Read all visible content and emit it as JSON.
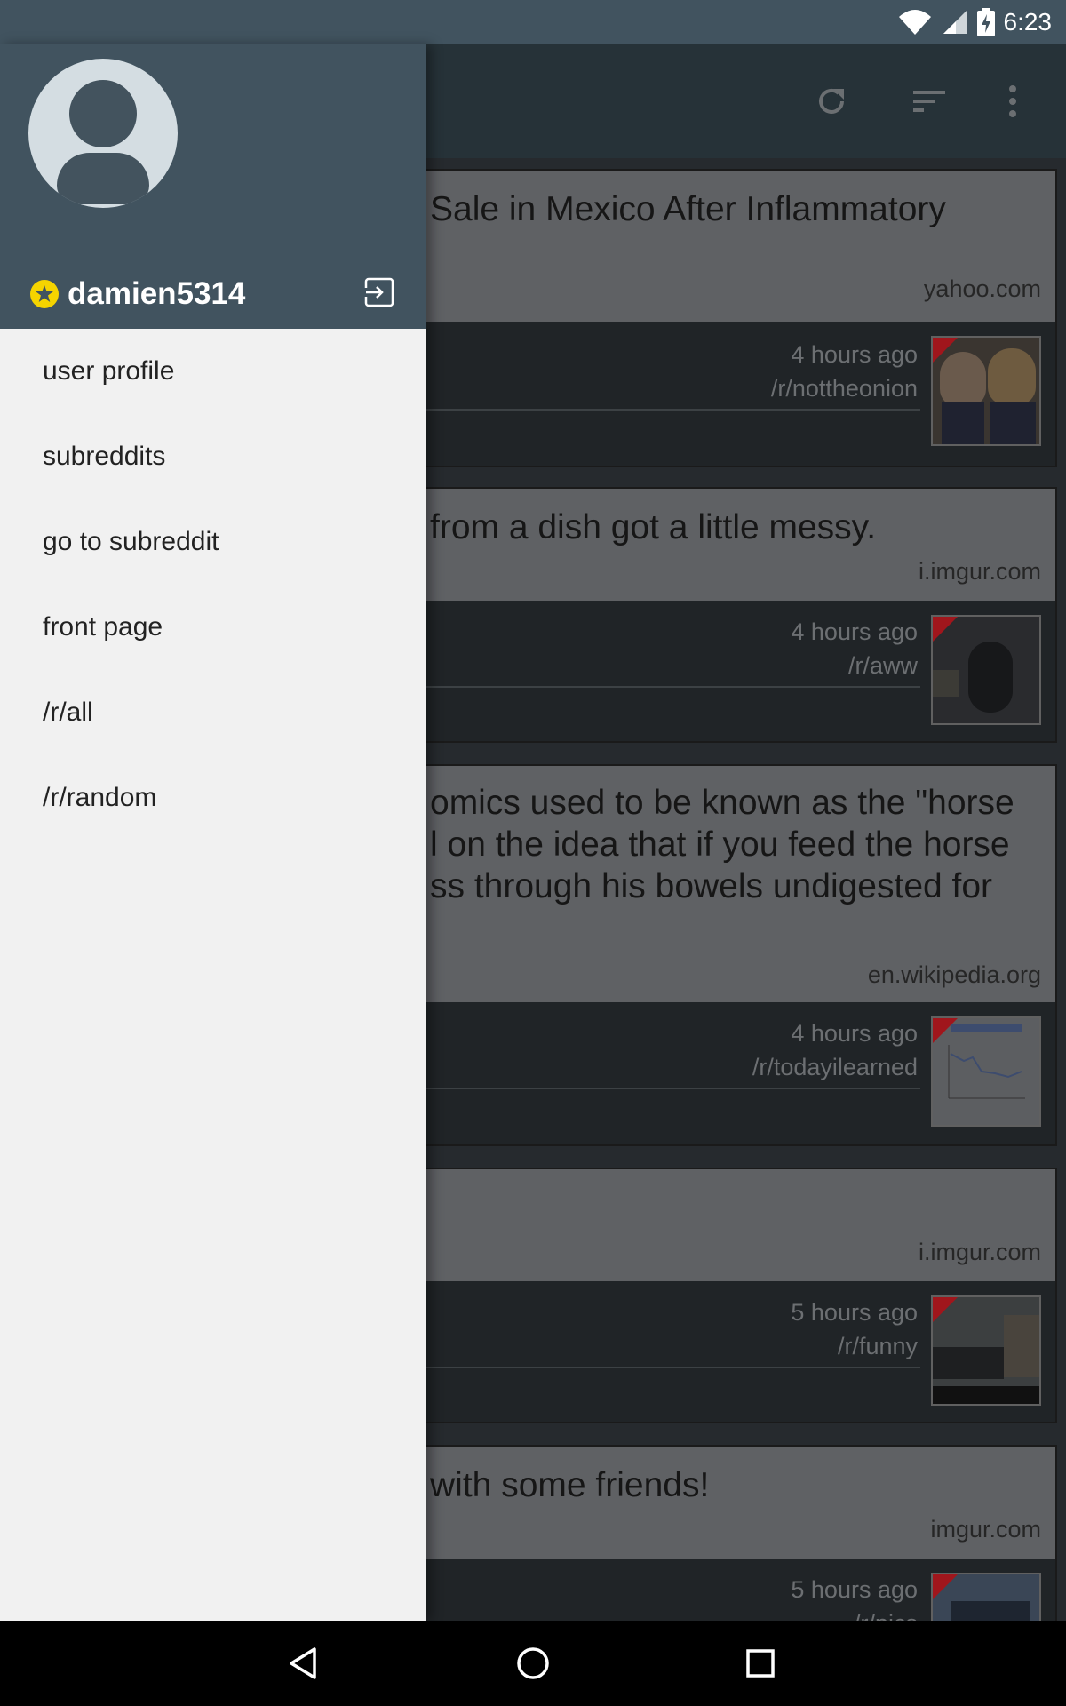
{
  "status_bar": {
    "time": "6:23",
    "icons": [
      "wifi-icon",
      "cell-signal-icon",
      "battery-charging-icon"
    ]
  },
  "app_bar": {
    "icons": [
      "refresh-icon",
      "sort-icon",
      "overflow-menu-icon"
    ]
  },
  "drawer": {
    "username": "damien5314",
    "badge_icon": "gold-star-icon",
    "logout_icon": "logout-icon",
    "items": [
      {
        "label": "user profile"
      },
      {
        "label": "subreddits"
      },
      {
        "label": "go to subreddit"
      },
      {
        "label": "front page"
      },
      {
        "label": "/r/all"
      },
      {
        "label": "/r/random"
      }
    ]
  },
  "posts": [
    {
      "title": "Sale in Mexico After Inflammatory",
      "domain": "yahoo.com",
      "time": "4 hours ago",
      "subreddit": "/r/nottheonion",
      "thumbnail": "thumbnail-trump-masks"
    },
    {
      "title": "from a dish got a little messy.",
      "domain": "i.imgur.com",
      "time": "4 hours ago",
      "subreddit": "/r/aww",
      "thumbnail": "thumbnail-kitten"
    },
    {
      "title": "omics used to be known as the \"horse\nl on the idea that if you feed the horse\nss through his bowels undigested for",
      "domain": "en.wikipedia.org",
      "time": "4 hours ago",
      "subreddit": "/r/todayilearned",
      "thumbnail": "thumbnail-chart"
    },
    {
      "title": "",
      "domain": "i.imgur.com",
      "time": "5 hours ago",
      "subreddit": "/r/funny",
      "thumbnail": "thumbnail-truck"
    },
    {
      "title": "with some friends!",
      "domain": "imgur.com",
      "time": "5 hours ago",
      "subreddit": "/r/pics",
      "thumbnail": "thumbnail-landscape"
    }
  ],
  "nav_bar": {
    "icons": [
      "back-icon",
      "home-icon",
      "recents-icon"
    ]
  },
  "colors": {
    "drawer_header": "#41535f",
    "app_bar": "#263238",
    "gold": "#f5d400"
  }
}
